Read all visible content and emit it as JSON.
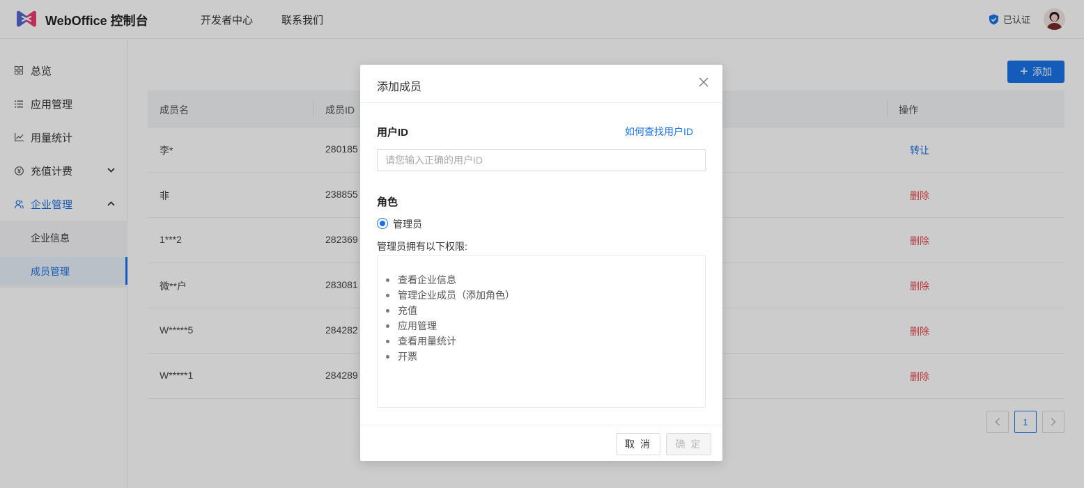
{
  "header": {
    "brand": "WebOffice 控制台",
    "nav": [
      "开发者中心",
      "联系我们"
    ],
    "verified_label": "已认证"
  },
  "sidebar": {
    "items": [
      {
        "label": "总览",
        "icon": "grid-icon"
      },
      {
        "label": "应用管理",
        "icon": "list-icon"
      },
      {
        "label": "用量统计",
        "icon": "line-chart-icon"
      },
      {
        "label": "充值计费",
        "icon": "yuan-icon",
        "arrow": "chevron-down-icon"
      },
      {
        "label": "企业管理",
        "icon": "users-icon",
        "arrow": "chevron-up-icon"
      }
    ],
    "sub_items": [
      {
        "label": "企业信息"
      },
      {
        "label": "成员管理",
        "active": true
      }
    ]
  },
  "main": {
    "add_button": "添加",
    "table": {
      "headers": [
        "成员名",
        "成员ID",
        "操作"
      ],
      "rows": [
        {
          "name": "李*",
          "id": "280185",
          "op": "转让",
          "op_type": "transfer"
        },
        {
          "name": "非",
          "id": "238855",
          "op": "删除",
          "op_type": "delete"
        },
        {
          "name": "1***2",
          "id": "282369",
          "op": "删除",
          "op_type": "delete"
        },
        {
          "name": "微**户",
          "id": "283081",
          "op": "删除",
          "op_type": "delete"
        },
        {
          "name": "W*****5",
          "id": "284282",
          "op": "删除",
          "op_type": "delete"
        },
        {
          "name": "W*****1",
          "id": "284289",
          "op": "删除",
          "op_type": "delete"
        }
      ]
    },
    "pagination": {
      "prev": "<",
      "current": "1",
      "next": ">"
    }
  },
  "modal": {
    "title": "添加成员",
    "user_id_label": "用户ID",
    "help_link": "如何查找用户ID",
    "user_id_placeholder": "请您输入正确的用户ID",
    "user_id_value": "",
    "role_label": "角色",
    "role_option": "管理员",
    "permissions_title": "管理员拥有以下权限:",
    "permissions": [
      "查看企业信息",
      "管理企业成员（添加角色）",
      "充值",
      "应用管理",
      "查看用量统计",
      "开票"
    ],
    "cancel": "取 消",
    "confirm": "确 定"
  },
  "colors": {
    "accent": "#1a73e8",
    "danger": "#e5484d"
  }
}
